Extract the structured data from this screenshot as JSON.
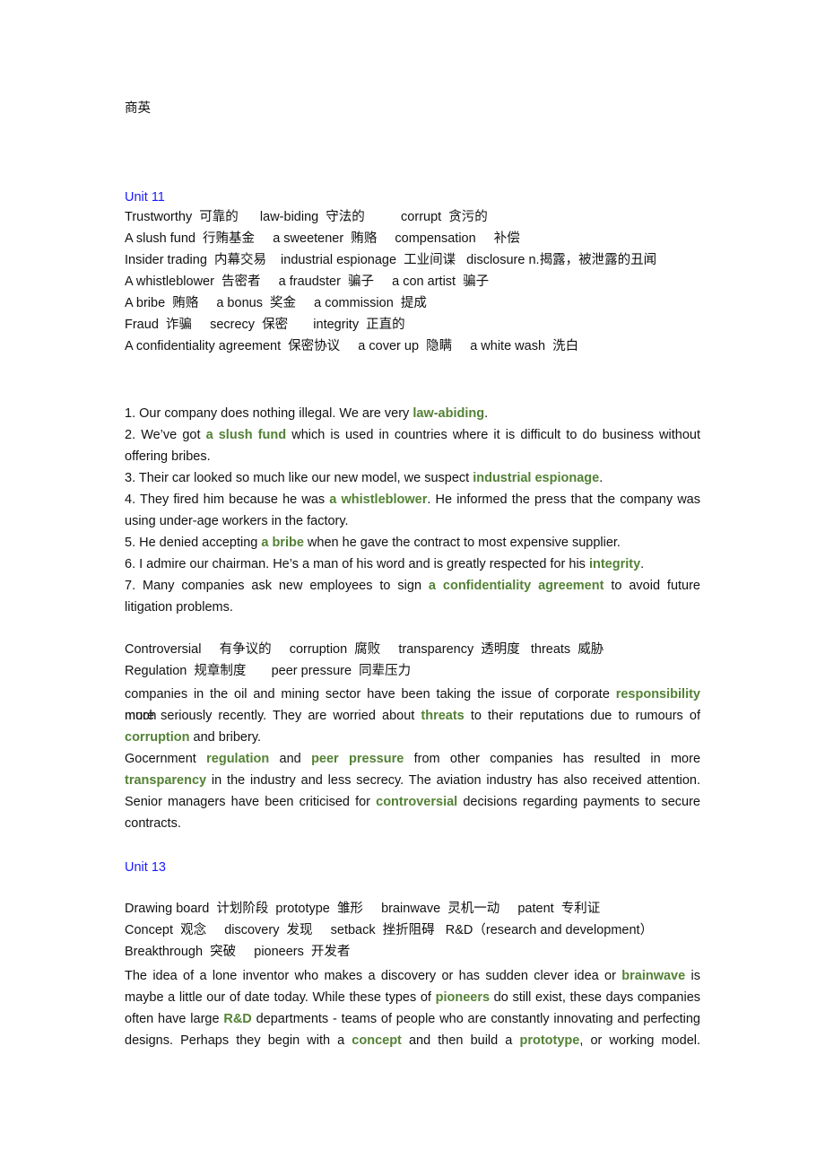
{
  "doc_title": "商英",
  "unit11": {
    "heading": "Unit 11",
    "vocab_lines": [
      "Trustworthy  可靠的      law-biding  守法的          corrupt  贪污的",
      "A slush fund  行贿基金     a sweetener  贿赂     compensation     补偿",
      "Insider trading  内幕交易    industrial espionage  工业间谍   disclosure n.揭露，被泄露的丑闻",
      "A whistleblower  告密者     a fraudster  骗子     a con artist  骗子",
      "A bribe  贿赂     a bonus  奖金     a commission  提成",
      "Fraud  诈骗     secrecy  保密       integrity  正直的",
      "A confidentiality agreement  保密协议     a cover up  隐瞒     a white wash  洗白"
    ],
    "sentences": [
      {
        "before": "1. Our company does nothing illegal. We are very ",
        "term": "law-abiding",
        "after": "."
      },
      {
        "before": "2. We’ve got ",
        "term": "a slush fund",
        "after": " which is used in countries where it is difficult to do business without",
        "cont": "offering bribes."
      },
      {
        "before": "3. Their car looked so much like our new model, we suspect ",
        "term": "industrial espionage",
        "after": "."
      },
      {
        "before": "4. They fired him because he was ",
        "term": "a whistleblower",
        "after": ". He informed the press that the company was",
        "cont": "using under-age workers in the factory."
      },
      {
        "before": "5. He denied accepting ",
        "term": "a bribe",
        "after": " when he gave the contract to most expensive supplier."
      },
      {
        "before": "6. I admire our chairman. He’s a man of his word and is greatly respected for his ",
        "term": "integrity",
        "after": "."
      },
      {
        "before": "7. Many companies ask new employees to sign ",
        "term": "a confidentiality agreement",
        "after": " to avoid future",
        "cont": "litigation problems."
      }
    ],
    "vocab2_lines": [
      "Controversial     有争议的     corruption  腐败     transparency  透明度   threats  威胁",
      "Regulation  规章制度       peer pressure  同辈压力"
    ],
    "paragraph": {
      "l1_before": "companies in the oil and mining sector have been taking the issue of corporate ",
      "l1_term": "responsibility",
      "l1_after": " much",
      "l2_before": "more seriously recently. They are worried about ",
      "l2_term": "threats",
      "l2_after": " to their reputations due to rumours of",
      "l3_term": "corruption",
      "l3_after": " and bribery.",
      "l4_before": "Gocernment ",
      "l4_term1": "regulation",
      "l4_mid": " and ",
      "l4_term2": "peer pressure",
      "l4_after": " from other companies has resulted in more",
      "l5_term": "transparency",
      "l5_after": " in the industry and less secrecy. The aviation industry has also received attention.",
      "l6_before": "Senior managers have been criticised for ",
      "l6_term": "controversial",
      "l6_after": " decisions regarding payments to secure",
      "l7": "contracts."
    }
  },
  "unit13": {
    "heading": "Unit 13",
    "vocab_lines": [
      "Drawing board  计划阶段  prototype  雏形     brainwave  灵机一动     patent  专利证",
      "Concept  观念     discovery  发现     setback  挫折阻碍   R&D（research and development）",
      "Breakthrough  突破     pioneers  开发者"
    ],
    "paragraph": {
      "l1_before": "The idea of a lone inventor who makes a discovery or has sudden clever idea or ",
      "l1_term": "brainwave",
      "l1_after": " is",
      "l2_before": "maybe a little our of date today. While these types of ",
      "l2_term": "pioneers",
      "l2_after": " do still exist, these days companies",
      "l3_before": "often have large ",
      "l3_term": "R&D",
      "l3_after": " departments - teams of people who are constantly innovating and perfecting",
      "l4_before": "designs. Perhaps they begin with a ",
      "l4_term1": "concept",
      "l4_mid": " and then build a ",
      "l4_term2": "prototype",
      "l4_after": ", or working model."
    }
  }
}
